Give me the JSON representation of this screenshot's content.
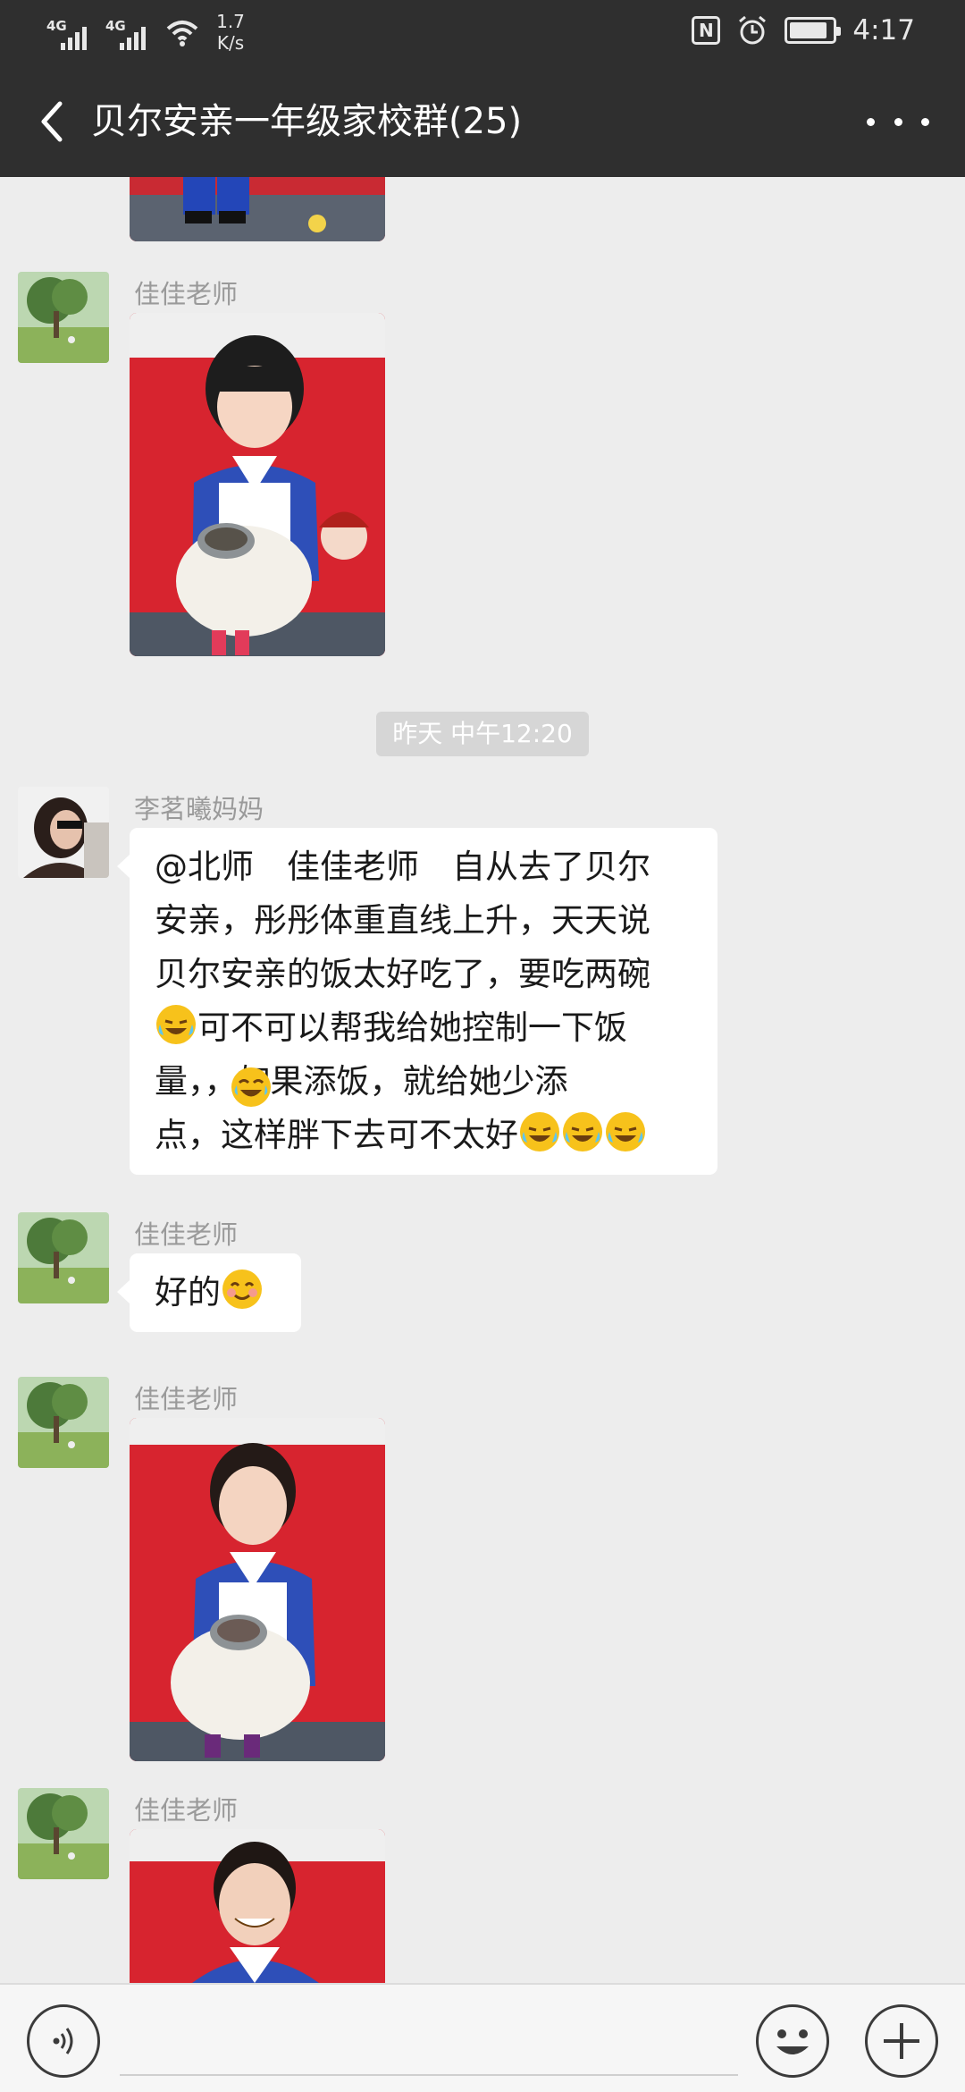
{
  "status_bar": {
    "signal_1_label": "4G",
    "signal_2_label": "4G",
    "net_speed_value": "1.7",
    "net_speed_unit": "K/s",
    "nfc_label": "N",
    "time": "4:17",
    "battery_level": 0.9
  },
  "header": {
    "title": "贝尔安亲一年级家校群(25)"
  },
  "messages": [
    {
      "kind": "image",
      "photo": "child-with-bowl-partial"
    },
    {
      "kind": "image",
      "sender": "佳佳老师",
      "photo": "girl-with-bowl"
    },
    {
      "kind": "time",
      "text": "昨天 中午12:20"
    },
    {
      "kind": "text",
      "sender": "李茗曦妈妈",
      "lines": [
        "@北师　佳佳老师　自从去了贝尔",
        "安亲，彤彤体重直线上升，天天说",
        "贝尔安亲的饭太好吃了，要吃两碗",
        "可不可以帮我给她控制一下饭",
        "量，，如果添饭，就给她少添",
        "点，这样胖下去可不太好"
      ]
    },
    {
      "kind": "text",
      "sender": "佳佳老师",
      "text": "好的"
    },
    {
      "kind": "image",
      "sender": "佳佳老师",
      "photo": "girl-with-bowl-2"
    },
    {
      "kind": "image",
      "sender": "佳佳老师",
      "photo": "boy-smiling"
    }
  ],
  "emojis": {
    "cry_laugh": "rolling-laughing-crying-emoji",
    "tears_of_joy": "tears-of-joy-emoji",
    "smile": "smiling-face-emoji"
  },
  "input_bar": {
    "placeholder": ""
  },
  "colors": {
    "header_bg": "#2f2f2f",
    "chat_bg": "#ededed",
    "bubble_bg": "#ffffff",
    "photo_bg": "#d7242f"
  }
}
